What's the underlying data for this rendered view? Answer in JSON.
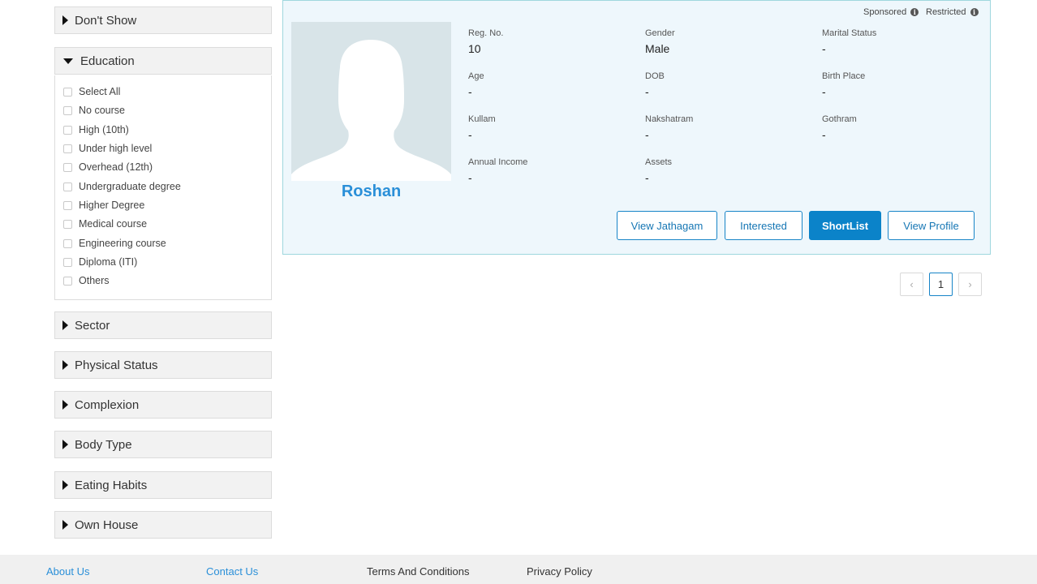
{
  "filters": {
    "dont_show": "Don't Show",
    "education": {
      "title": "Education",
      "options": [
        "Select All",
        "No course",
        "High (10th)",
        "Under high level",
        "Overhead (12th)",
        "Undergraduate degree",
        "Higher Degree",
        "Medical course",
        "Engineering course",
        "Diploma (ITI)",
        "Others"
      ]
    },
    "sector": "Sector",
    "physical_status": "Physical Status",
    "complexion": "Complexion",
    "body_type": "Body Type",
    "eating_habits": "Eating Habits",
    "own_house": "Own House"
  },
  "profile": {
    "name": "Roshan",
    "tags": {
      "sponsored": "Sponsored",
      "restricted": "Restricted"
    },
    "fields": {
      "reg_no": {
        "label": "Reg. No.",
        "value": "10"
      },
      "gender": {
        "label": "Gender",
        "value": "Male"
      },
      "marital_status": {
        "label": "Marital Status",
        "value": "-"
      },
      "age": {
        "label": "Age",
        "value": "-"
      },
      "dob": {
        "label": "DOB",
        "value": "-"
      },
      "birth_place": {
        "label": "Birth Place",
        "value": "-"
      },
      "kullam": {
        "label": "Kullam",
        "value": "-"
      },
      "nakshatram": {
        "label": "Nakshatram",
        "value": "-"
      },
      "gothram": {
        "label": "Gothram",
        "value": "-"
      },
      "annual_income": {
        "label": "Annual Income",
        "value": "-"
      },
      "assets": {
        "label": "Assets",
        "value": "-"
      }
    },
    "buttons": {
      "view_jathagam": "View Jathagam",
      "interested": "Interested",
      "shortlist": "ShortList",
      "view_profile": "View Profile"
    }
  },
  "pagination": {
    "prev": "‹",
    "current": "1",
    "next": "›"
  },
  "footer": {
    "about": "About Us",
    "contact": "Contact Us",
    "terms": "Terms And Conditions",
    "privacy": "Privacy Policy"
  },
  "colors": {
    "accent": "#0b83c9",
    "link": "#2a8fd8",
    "card_bg": "#eef7fc"
  }
}
